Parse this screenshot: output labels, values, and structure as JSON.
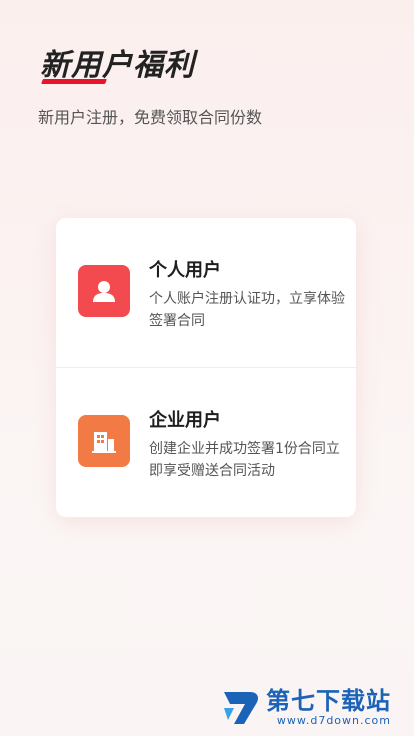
{
  "header": {
    "title": "新用户福利",
    "subtitle": "新用户注册，免费领取合同份数"
  },
  "options": [
    {
      "title": "个人用户",
      "description": "个人账户注册认证功，立享体验签署合同",
      "icon": "person-icon",
      "color": "#f24a4e"
    },
    {
      "title": "企业用户",
      "description": "创建企业并成功签署1份合同立即享受赠送合同活动",
      "icon": "building-icon",
      "color": "#f27a44"
    }
  ],
  "watermark": {
    "name": "第七下载站",
    "url": "www.d7down.com"
  },
  "colors": {
    "accent": "#e8142b",
    "watermark": "#1b63b7"
  }
}
